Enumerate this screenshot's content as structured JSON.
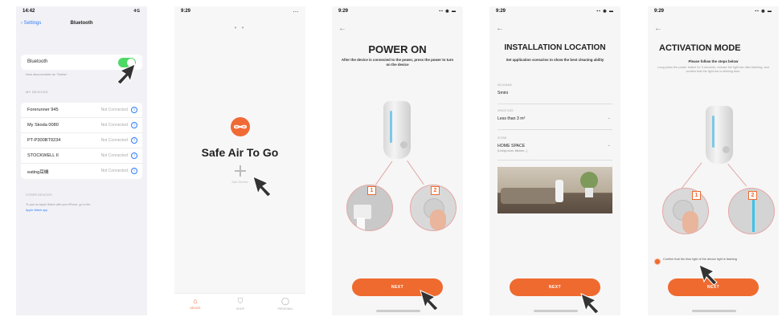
{
  "phone1": {
    "status_time": "14:42",
    "status_icons": "4G",
    "nav_back": "Settings",
    "nav_title": "Bluetooth",
    "bluetooth_label": "Bluetooth",
    "discoverable_note": "Now discoverable as \"Hatria\".",
    "my_devices_header": "MY DEVICES",
    "devices": [
      {
        "name": "Forerunner 945",
        "status": "Not Connected"
      },
      {
        "name": "My Skoda 0080",
        "status": "Not Connected"
      },
      {
        "name": "PT-P300BT9234",
        "status": "Not Connected"
      },
      {
        "name": "STOCKWELL II",
        "status": "Not Connected"
      },
      {
        "name": "eating耳機",
        "status": "Not Connected"
      }
    ],
    "other_devices_header": "OTHER DEVICES",
    "other_note": "To pair an Apple Watch with your iPhone, go to the",
    "other_link": "Apple Watch app"
  },
  "phone2": {
    "status_time": "9:29",
    "status_icons": "...",
    "page_dots": "• •",
    "app_title": "Safe Air To Go",
    "add_device_label": "Add Device",
    "tabs": [
      {
        "icon": "home-icon",
        "glyph": "⌂",
        "label": "DEVICE"
      },
      {
        "icon": "cart-icon",
        "glyph": "⛉",
        "label": "SHOP"
      },
      {
        "icon": "profile-icon",
        "glyph": "◯",
        "label": "PERSONAL"
      }
    ]
  },
  "phone3": {
    "status_time": "9:29",
    "title": "POWER ON",
    "subtitle": "After the device is connected to the power, press the power to turn on the device",
    "badge1": "1",
    "badge2": "2",
    "next_label": "NEXT"
  },
  "phone4": {
    "status_time": "9:29",
    "title": "INSTALLATION LOCATION",
    "subtitle": "Set application scenarios to show the best cleaning ability",
    "fields": [
      {
        "label": "NICKNAME",
        "value": "Smini",
        "hint": ""
      },
      {
        "label": "SPACE SIZE",
        "value": "Less than 3 m²",
        "hint": ""
      },
      {
        "label": "SCENE",
        "value": "HOME SPACE",
        "hint": "(Living room, kitchen...)"
      }
    ],
    "next_label": "NEXT"
  },
  "phone5": {
    "status_time": "9:29",
    "title": "ACTIVATION MODE",
    "subtitle": "Please follow the steps below",
    "instructions": "Long press the power button for 5 seconds, release the light bar after flashing, and confirm that the light bar is blinking blue.",
    "badge1": "1",
    "badge2": "2",
    "confirm_text": "Confirm that the blue light of the device light is flashing",
    "next_label": "NEXT"
  },
  "colors": {
    "accent": "#ef6a2f",
    "ios_green": "#4cd964",
    "ios_blue": "#2f7cf6",
    "light_blue": "#39c3ea"
  }
}
